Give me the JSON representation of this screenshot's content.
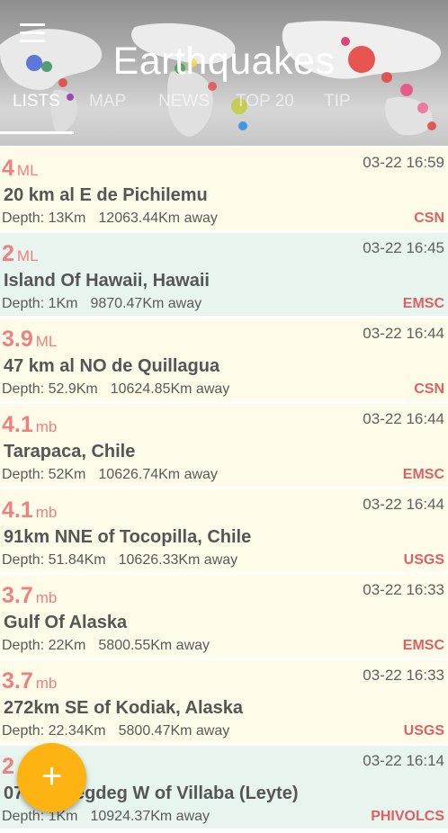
{
  "header": {
    "title": "Earthquakes",
    "tabs": [
      {
        "label": "LISTS",
        "active": true
      },
      {
        "label": "MAP",
        "active": false
      },
      {
        "label": "NEWS",
        "active": false
      },
      {
        "label": "TOP 20",
        "active": false
      },
      {
        "label": "TIP",
        "active": false
      }
    ]
  },
  "quakes": [
    {
      "mag": "4",
      "unit": "ML",
      "time": "03-22 16:59",
      "place": "20 km al E de Pichilemu",
      "depth": "Depth: 13Km",
      "distance": "12063.44Km away",
      "source": "CSN",
      "bg": "cream"
    },
    {
      "mag": "2",
      "unit": "ML",
      "time": "03-22 16:45",
      "place": "Island Of Hawaii, Hawaii",
      "depth": "Depth: 1Km",
      "distance": "9870.47Km away",
      "source": "EMSC",
      "bg": "mint"
    },
    {
      "mag": "3.9",
      "unit": "ML",
      "time": "03-22 16:44",
      "place": "47 km al NO de Quillagua",
      "depth": "Depth: 52.9Km",
      "distance": "10624.85Km away",
      "source": "CSN",
      "bg": "cream"
    },
    {
      "mag": "4.1",
      "unit": "mb",
      "time": "03-22 16:44",
      "place": "Tarapaca, Chile",
      "depth": "Depth: 52Km",
      "distance": "10626.74Km away",
      "source": "EMSC",
      "bg": "cream"
    },
    {
      "mag": "4.1",
      "unit": "mb",
      "time": "03-22 16:44",
      "place": "91km NNE of Tocopilla, Chile",
      "depth": "Depth: 51.84Km",
      "distance": "10626.33Km away",
      "source": "USGS",
      "bg": "cream"
    },
    {
      "mag": "3.7",
      "unit": "mb",
      "time": "03-22 16:33",
      "place": "Gulf Of Alaska",
      "depth": "Depth: 22Km",
      "distance": "5800.55Km away",
      "source": "EMSC",
      "bg": "cream"
    },
    {
      "mag": "3.7",
      "unit": "mb",
      "time": "03-22 16:33",
      "place": "272km SE of Kodiak, Alaska",
      "depth": "Depth: 22.34Km",
      "distance": "5800.47Km away",
      "source": "USGS",
      "bg": "cream"
    },
    {
      "mag": "2",
      "unit": "",
      "time": "03-22 16:14",
      "place": "07 5 63degdeg W of Villaba (Leyte)",
      "depth": "Depth: 1Km",
      "distance": "10924.37Km away",
      "source": "PHIVOLCS",
      "bg": "mint"
    }
  ],
  "fab": {
    "label": "+"
  },
  "colors": {
    "magnitude": "#f08080",
    "source": "#e06060",
    "fab": "#fdb412",
    "cream_row": "#fefce8",
    "mint_row": "#e8f4ee"
  }
}
